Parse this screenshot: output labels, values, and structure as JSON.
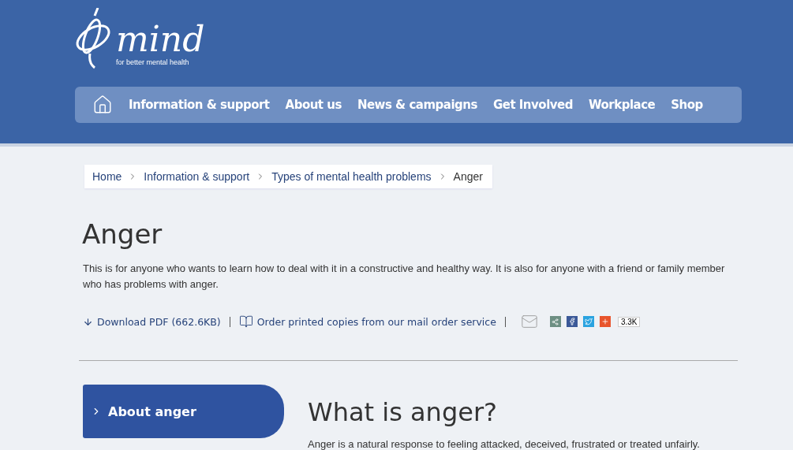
{
  "logo": {
    "name": "mind",
    "tagline": "for better mental health"
  },
  "nav": [
    "Information & support",
    "About us",
    "News & campaigns",
    "Get Involved",
    "Workplace",
    "Shop"
  ],
  "breadcrumb": [
    "Home",
    "Information & support",
    "Types of mental health problems",
    "Anger"
  ],
  "title": "Anger",
  "intro": "This is for anyone who wants to learn how to deal with it in a constructive and healthy way. It is also for anyone with a friend or family member who has problems with anger.",
  "actions": [
    {
      "kind": "download",
      "label": "Download PDF (662.6KB)"
    },
    {
      "kind": "order",
      "label": "Order printed copies from our mail order service"
    }
  ],
  "share_count": "3.3K",
  "side_menu": [
    "About anger"
  ],
  "section": {
    "heading": "What is anger?",
    "text": "Anger is a natural response to feeling attacked, deceived, frustrated or treated unfairly."
  }
}
